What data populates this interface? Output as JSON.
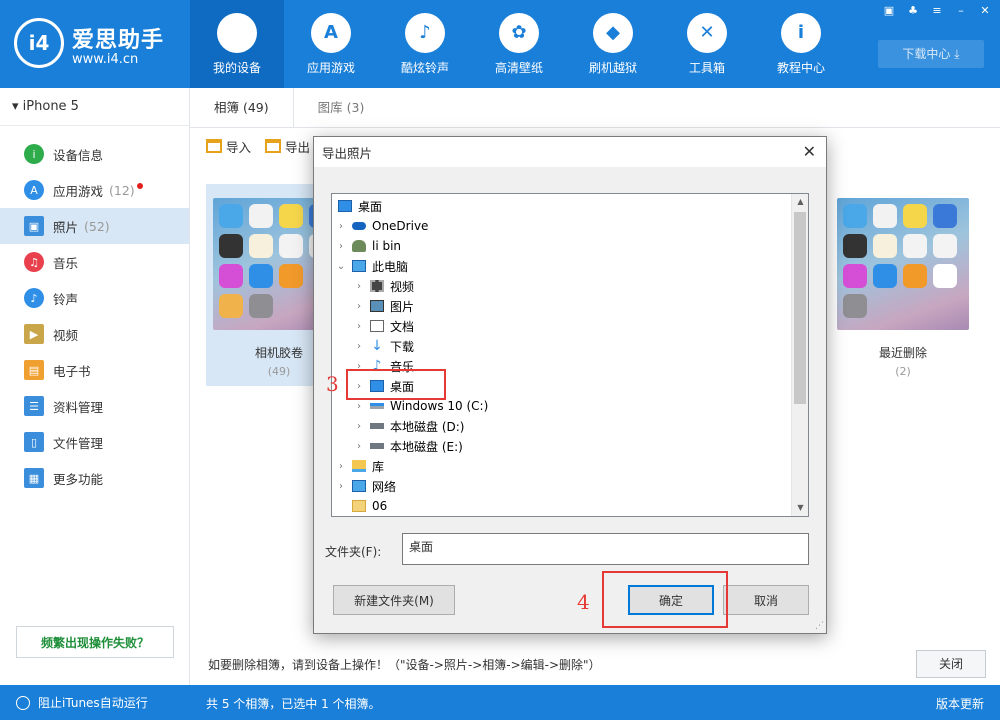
{
  "app": {
    "name": "爱思助手",
    "url": "www.i4.cn",
    "logo_text": "i4"
  },
  "nav": [
    {
      "label": "我的设备",
      "icon": "apple-icon",
      "glyph": ""
    },
    {
      "label": "应用游戏",
      "icon": "appstore-icon",
      "glyph": "A"
    },
    {
      "label": "酷炫铃声",
      "icon": "bell-icon",
      "glyph": "♪"
    },
    {
      "label": "高清壁纸",
      "icon": "flower-icon",
      "glyph": "✿"
    },
    {
      "label": "刷机越狱",
      "icon": "dropbox-icon",
      "glyph": "◆"
    },
    {
      "label": "工具箱",
      "icon": "tools-icon",
      "glyph": "✕"
    },
    {
      "label": "教程中心",
      "icon": "info-icon",
      "glyph": "i"
    }
  ],
  "download_center": "下载中心",
  "device": "iPhone 5",
  "sidebar": [
    {
      "label": "设备信息",
      "icon": "info-circle-icon",
      "color": "#2eab4a",
      "glyph": "i",
      "count": ""
    },
    {
      "label": "应用游戏",
      "icon": "appstore-icon",
      "color": "#2f8fe6",
      "glyph": "A",
      "count": "(12)"
    },
    {
      "label": "照片",
      "icon": "photo-icon",
      "color": "#3b8edb",
      "glyph": "▣",
      "count": "(52)"
    },
    {
      "label": "音乐",
      "icon": "music-icon",
      "color": "#e8414d",
      "glyph": "♫",
      "count": ""
    },
    {
      "label": "铃声",
      "icon": "bell-icon",
      "color": "#2f8fe6",
      "glyph": "♪",
      "count": ""
    },
    {
      "label": "视频",
      "icon": "video-icon",
      "color": "#c9a64a",
      "glyph": "▶",
      "count": ""
    },
    {
      "label": "电子书",
      "icon": "book-icon",
      "color": "#f0a030",
      "glyph": "▤",
      "count": ""
    },
    {
      "label": "资料管理",
      "icon": "contacts-icon",
      "color": "#3b8edb",
      "glyph": "☰",
      "count": ""
    },
    {
      "label": "文件管理",
      "icon": "file-icon",
      "color": "#3b8edb",
      "glyph": "▯",
      "count": ""
    },
    {
      "label": "更多功能",
      "icon": "grid-icon",
      "color": "#3b8edb",
      "glyph": "▦",
      "count": ""
    }
  ],
  "help_button": "频繁出现操作失败？",
  "tabs": [
    {
      "label": "相簿 (49)"
    },
    {
      "label": "图库 (3)"
    }
  ],
  "toolbar": {
    "import": "导入",
    "export": "导出"
  },
  "albums": [
    {
      "name": "相机胶卷",
      "count": "(49)"
    },
    {
      "name": "最近删除",
      "count": "(2)"
    }
  ],
  "notice": "如要删除相簿，请到设备上操作！（\"设备->照片->相簿->编辑->删除\"）",
  "close_label": "关闭",
  "status": {
    "itunes": "阻止iTunes自动运行",
    "selection": "共 5 个相簿，已选中 1 个相簿。",
    "right": "版本更新"
  },
  "dialog": {
    "title": "导出照片",
    "tree": [
      {
        "label": "桌面",
        "level": 0,
        "chev": "",
        "icon": "desktop-icon"
      },
      {
        "label": "OneDrive",
        "level": 1,
        "chev": "›",
        "icon": "cloud-icon"
      },
      {
        "label": "li bin",
        "level": 1,
        "chev": "›",
        "icon": "user-icon"
      },
      {
        "label": "此电脑",
        "level": 1,
        "chev": "⌄",
        "icon": "computer-icon"
      },
      {
        "label": "视频",
        "level": 2,
        "chev": "›",
        "icon": "video-folder-icon"
      },
      {
        "label": "图片",
        "level": 2,
        "chev": "›",
        "icon": "picture-folder-icon"
      },
      {
        "label": "文档",
        "level": 2,
        "chev": "›",
        "icon": "document-folder-icon"
      },
      {
        "label": "下载",
        "level": 2,
        "chev": "›",
        "icon": "download-folder-icon"
      },
      {
        "label": "音乐",
        "level": 2,
        "chev": "›",
        "icon": "music-folder-icon"
      },
      {
        "label": "桌面",
        "level": 2,
        "chev": "›",
        "icon": "desktop-icon"
      },
      {
        "label": "Windows 10 (C:)",
        "level": 2,
        "chev": "›",
        "icon": "drive-icon"
      },
      {
        "label": "本地磁盘 (D:)",
        "level": 2,
        "chev": "›",
        "icon": "drive-icon"
      },
      {
        "label": "本地磁盘 (E:)",
        "level": 2,
        "chev": "›",
        "icon": "drive-icon"
      },
      {
        "label": "库",
        "level": 1,
        "chev": "›",
        "icon": "library-icon"
      },
      {
        "label": "网络",
        "level": 1,
        "chev": "›",
        "icon": "network-icon"
      },
      {
        "label": "06",
        "level": 1,
        "chev": "",
        "icon": "folder-icon"
      }
    ],
    "folder_label": "文件夹(F):",
    "folder_value": "桌面",
    "new_folder": "新建文件夹(M)",
    "ok": "确定",
    "cancel": "取消"
  },
  "annotations": {
    "step3": "3",
    "step4": "4"
  },
  "colors": {
    "brand": "#1a7fd8",
    "annotation": "#e53935"
  }
}
